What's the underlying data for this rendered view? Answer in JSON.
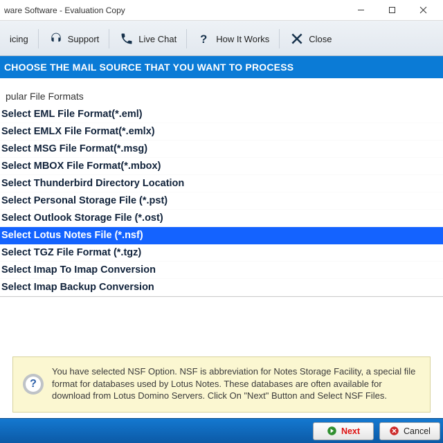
{
  "window": {
    "title": "ware Software - Evaluation Copy"
  },
  "toolbar": {
    "pricing": "icing",
    "support": "Support",
    "livechat": "Live Chat",
    "howitworks": "How It Works",
    "close": "Close"
  },
  "headline": "CHOOSE THE MAIL SOURCE THAT YOU WANT TO PROCESS",
  "section_label": "pular File Formats",
  "formats": [
    "Select EML File Format(*.eml)",
    "Select EMLX File Format(*.emlx)",
    "Select MSG File Format(*.msg)",
    "Select MBOX File Format(*.mbox)",
    "Select Thunderbird Directory Location",
    "Select Personal Storage File (*.pst)",
    "Select Outlook Storage File (*.ost)",
    "Select Lotus Notes File (*.nsf)",
    "Select TGZ File Format (*.tgz)",
    "Select Imap To Imap Conversion",
    "Select Imap Backup Conversion"
  ],
  "selected_index": 7,
  "info": "You have selected NSF Option. NSF is abbreviation for Notes Storage Facility, a special file format for databases used by Lotus Notes. These databases are often available for download from Lotus Domino Servers. Click On \"Next\" Button and Select NSF Files.",
  "footer": {
    "next": "Next",
    "cancel": "Cancel"
  }
}
